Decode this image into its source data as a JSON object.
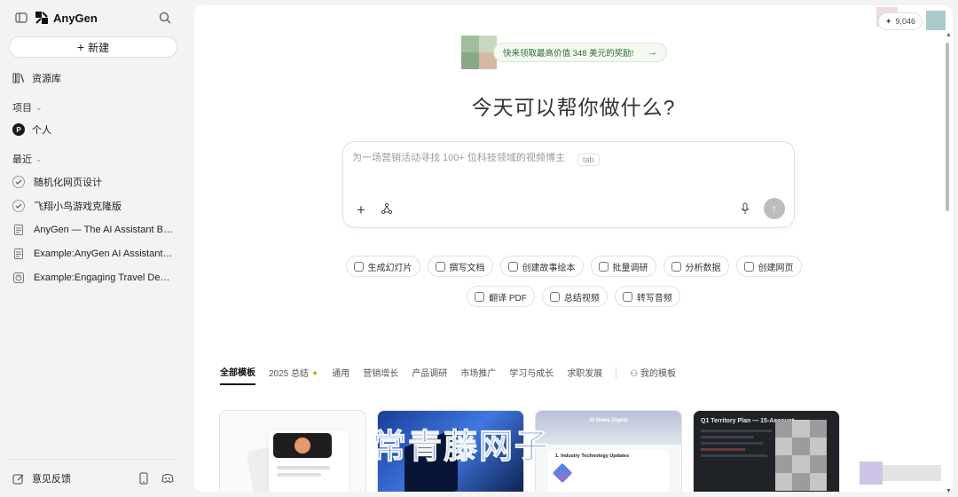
{
  "sidebar": {
    "brand": "AnyGen",
    "new_label": "新建",
    "library_label": "资源库",
    "projects_label": "项目",
    "personal_label": "个人",
    "personal_avatar": "P",
    "recent_label": "最近",
    "recent_items": [
      {
        "label": "随机化网页设计",
        "icon": "check-circle-icon"
      },
      {
        "label": "飞翔小鸟游戏克隆版",
        "icon": "check-circle-icon"
      },
      {
        "label": "AnyGen — The AI Assistant Bui...",
        "icon": "document-icon"
      },
      {
        "label": "Example:AnyGen AI Assistant f...",
        "icon": "document-icon"
      },
      {
        "label": "Example:Engaging Travel Desti...",
        "icon": "chart-pie-icon"
      }
    ],
    "feedback_label": "意见反馈"
  },
  "header": {
    "credits": "9,046"
  },
  "promo": {
    "text": "快来领取最高价值 348 美元的奖励!"
  },
  "main": {
    "headline": "今天可以帮你做什么?",
    "composer": {
      "placeholder": "为一场营销活动寻找 100+ 位科技领域的视频博主",
      "tab_hint": "tab"
    },
    "actions_row1": [
      {
        "label": "生成幻灯片"
      },
      {
        "label": "撰写文档"
      },
      {
        "label": "创建故事绘本"
      },
      {
        "label": "批量调研"
      },
      {
        "label": "分析数据"
      },
      {
        "label": "创建网页"
      }
    ],
    "actions_row2": [
      {
        "label": "翻译 PDF"
      },
      {
        "label": "总结视频"
      },
      {
        "label": "转写音频"
      }
    ],
    "tabs": [
      {
        "label": "全部模板",
        "active": true
      },
      {
        "label": "2025 总结"
      },
      {
        "label": "通用"
      },
      {
        "label": "营销增长"
      },
      {
        "label": "产品调研"
      },
      {
        "label": "市场推广"
      },
      {
        "label": "学习与成长"
      },
      {
        "label": "求职发展"
      },
      {
        "label": "我的模板"
      }
    ],
    "cards": {
      "card3_title": "AI News Digest",
      "card3_section": "1. Industry Technology Updates",
      "card4_title": "Q1 Territory Plan — 15-Account"
    }
  },
  "watermark": "常青藤网子",
  "colors": {
    "accent_promo": "#2f6b3a",
    "watermark": "#2a6fcf"
  }
}
